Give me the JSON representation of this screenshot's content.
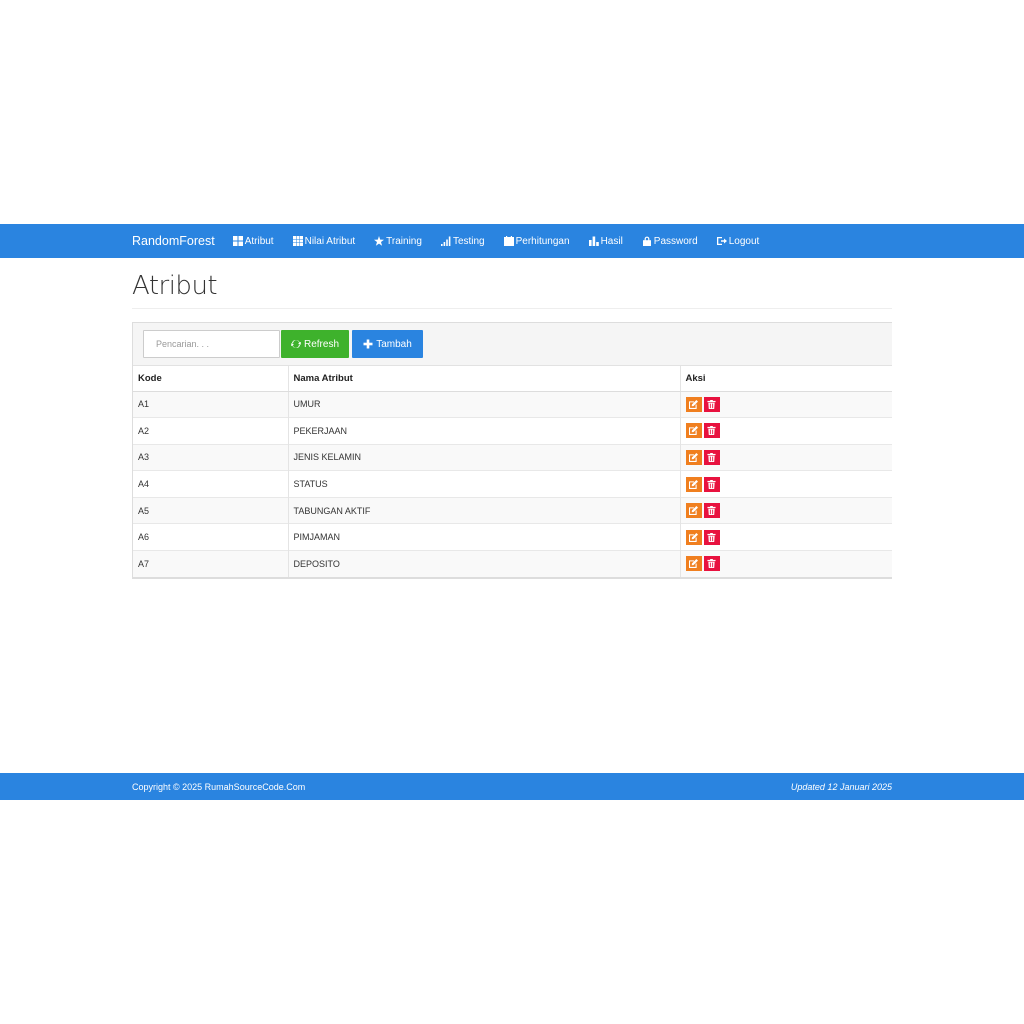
{
  "nav": {
    "brand": "RandomForest",
    "items": [
      {
        "label": "Atribut",
        "icon": "grid-icon"
      },
      {
        "label": "Nilai Atribut",
        "icon": "table-icon"
      },
      {
        "label": "Training",
        "icon": "star-icon"
      },
      {
        "label": "Testing",
        "icon": "signal-icon"
      },
      {
        "label": "Perhitungan",
        "icon": "calendar-icon"
      },
      {
        "label": "Hasil",
        "icon": "bar-chart-icon"
      },
      {
        "label": "Password",
        "icon": "lock-icon"
      },
      {
        "label": "Logout",
        "icon": "logout-icon"
      }
    ]
  },
  "page": {
    "title": "Atribut"
  },
  "toolbar": {
    "search_placeholder": "Pencarian. . .",
    "refresh_label": "Refresh",
    "add_label": "Tambah"
  },
  "table": {
    "headers": [
      "Kode",
      "Nama Atribut",
      "Aksi"
    ],
    "rows": [
      {
        "kode": "A1",
        "nama": "UMUR"
      },
      {
        "kode": "A2",
        "nama": "PEKERJAAN"
      },
      {
        "kode": "A3",
        "nama": "JENIS KELAMIN"
      },
      {
        "kode": "A4",
        "nama": "STATUS"
      },
      {
        "kode": "A5",
        "nama": "TABUNGAN AKTIF"
      },
      {
        "kode": "A6",
        "nama": "PIMJAMAN"
      },
      {
        "kode": "A7",
        "nama": "DEPOSITO"
      }
    ]
  },
  "footer": {
    "copyright": "Copyright © 2025 RumahSourceCode.Com",
    "updated": "Updated 12 Januari 2025"
  },
  "colors": {
    "primary": "#2a84e0",
    "success": "#3eb22c",
    "edit": "#f07f1f",
    "delete": "#e8123f"
  }
}
